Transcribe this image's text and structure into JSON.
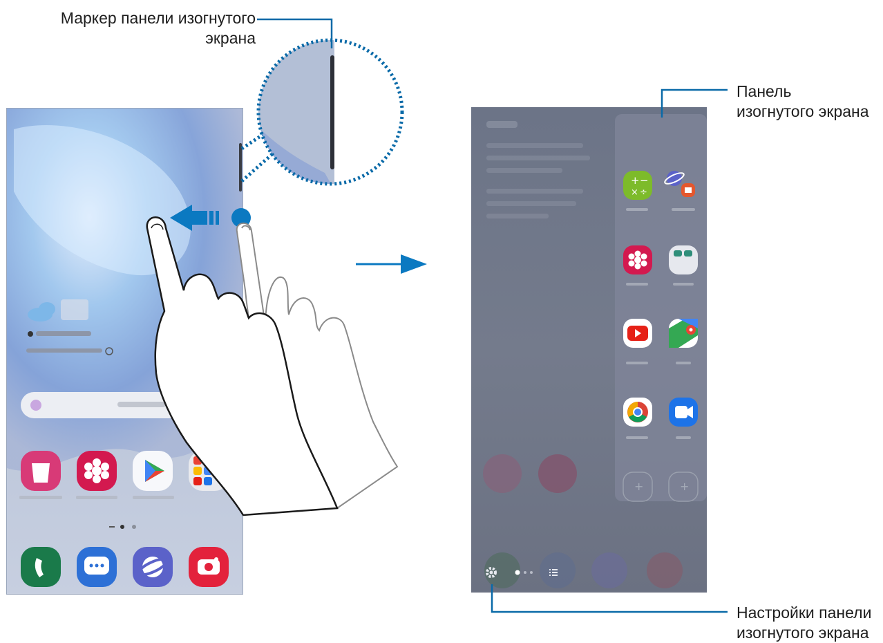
{
  "callouts": {
    "handle_label": [
      "Маркер панели изогнутого",
      "экрана"
    ],
    "panel_label": [
      "Панель",
      "изогнутого экрана"
    ],
    "settings_label": [
      "Настройки панели",
      "изогнутого экрана"
    ]
  },
  "colors": {
    "callout_line": "#0a6aa8",
    "arrow": "#0b79c1",
    "phone_left_bg": "#c4cde0",
    "phone_right_bg": "#707789"
  },
  "left_screen": {
    "apps_row": [
      {
        "icon": "galaxy-store-icon",
        "color": "#e23f6a"
      },
      {
        "icon": "gallery-icon",
        "color": "#d3194f"
      },
      {
        "icon": "play-store-icon",
        "color": "#ffffff"
      },
      {
        "icon": "google-folder-icon",
        "color": "#e9eaee"
      }
    ],
    "dock": [
      {
        "icon": "phone-icon",
        "color": "#1a7a4a"
      },
      {
        "icon": "messages-icon",
        "color": "#2d70d6"
      },
      {
        "icon": "internet-icon",
        "color": "#5b62c9"
      },
      {
        "icon": "camera-icon",
        "color": "#e3223c"
      }
    ]
  },
  "edge_panel": {
    "apps": [
      {
        "icon": "calculator-icon",
        "color": "#7dbb2a"
      },
      {
        "icon": "samsung-notes-pair-icon",
        "color": "#e4e6ee"
      },
      {
        "icon": "gallery-icon",
        "color": "#d3194f"
      },
      {
        "icon": "folder-icon",
        "color": "#e6e8ee"
      },
      {
        "icon": "youtube-icon",
        "color": "#e62117"
      },
      {
        "icon": "maps-icon",
        "color": "#ffffff"
      },
      {
        "icon": "chrome-icon",
        "color": "#ffffff"
      },
      {
        "icon": "duo-icon",
        "color": "#1d73e8"
      },
      {
        "icon": "add-slot-icon",
        "color": "#9aa0ad"
      },
      {
        "icon": "add-slot-icon",
        "color": "#9aa0ad"
      }
    ],
    "footer_icons": [
      "settings-gear-icon",
      "page-indicator",
      "list-icon"
    ]
  }
}
